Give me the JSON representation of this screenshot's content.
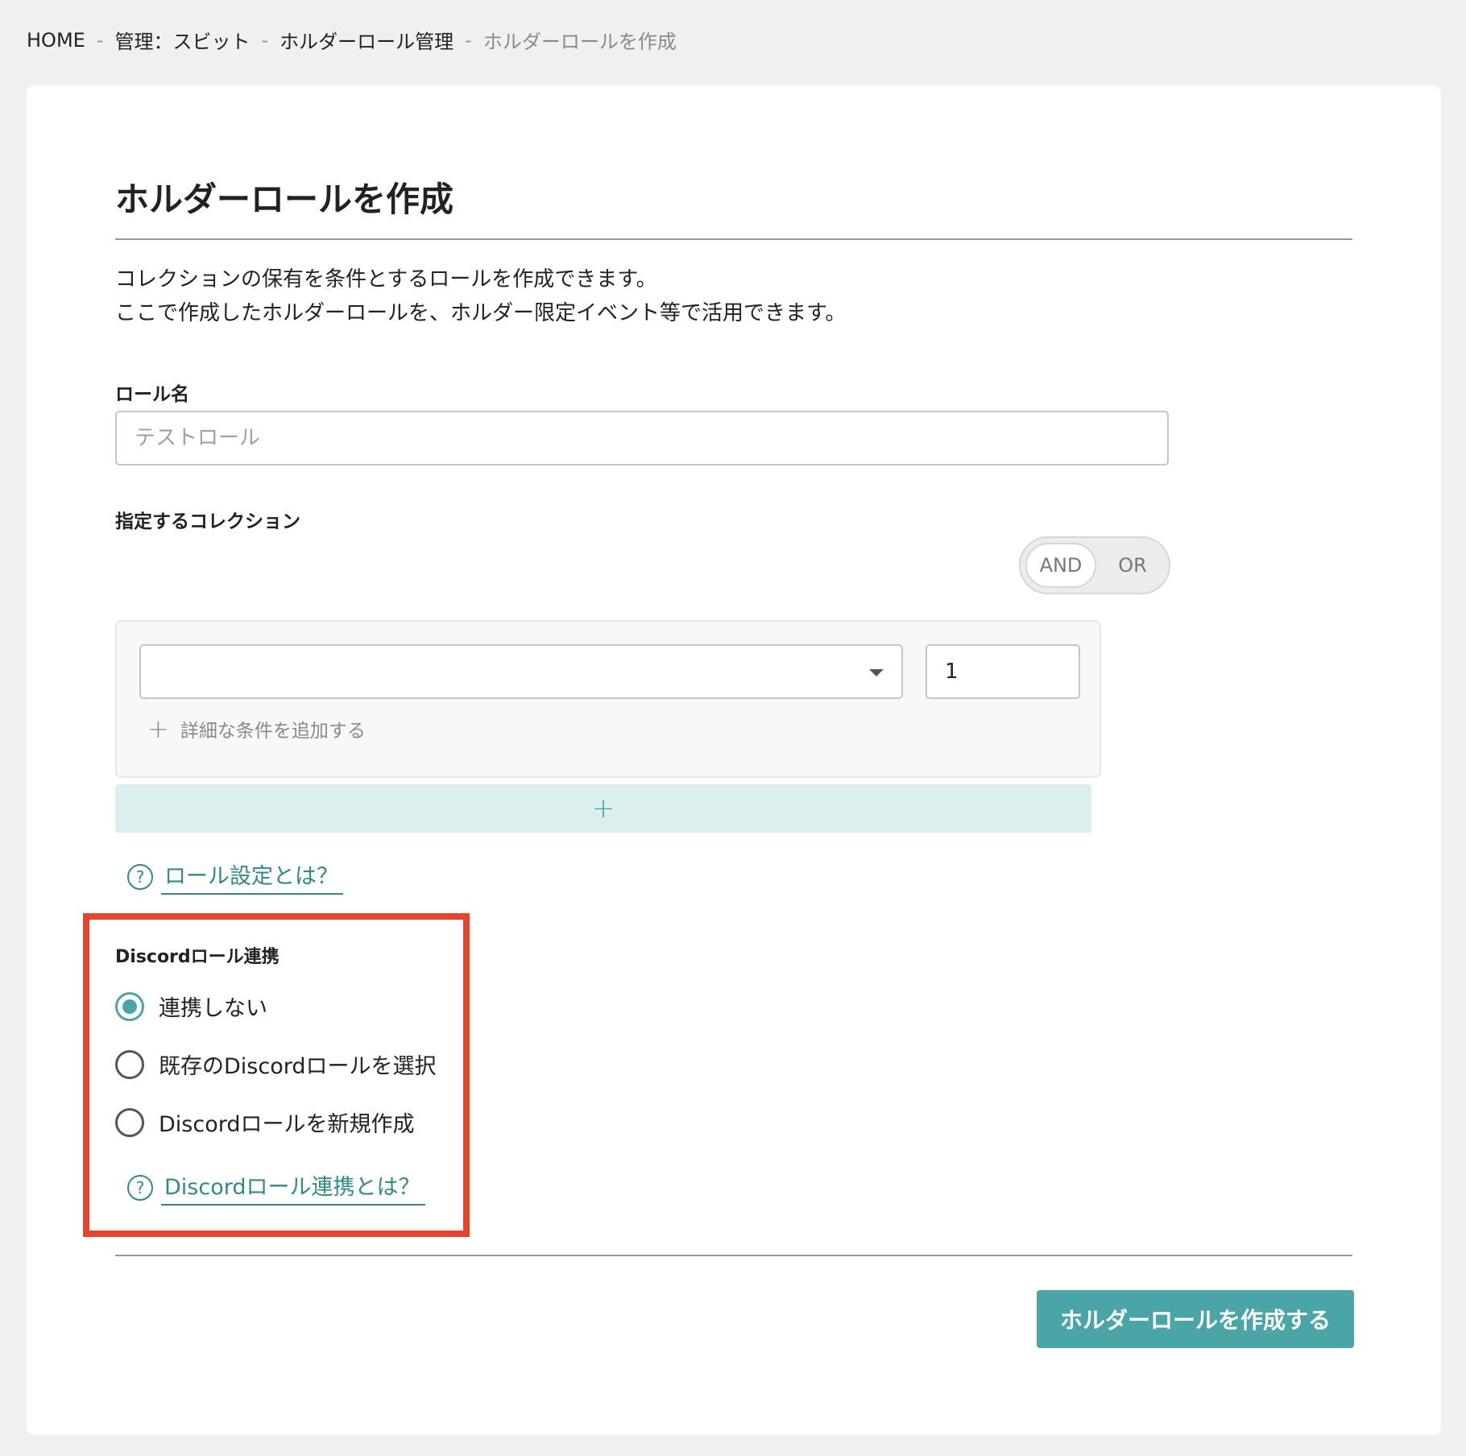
{
  "breadcrumb": {
    "items": [
      "HOME",
      "管理：スビット",
      "ホルダーロール管理"
    ],
    "separator": "-",
    "current": "ホルダーロールを作成"
  },
  "page": {
    "title": "ホルダーロールを作成",
    "description_line1": "コレクションの保有を条件とするロールを作成できます。",
    "description_line2": "ここで作成したホルダーロールを、ホルダー限定イベント等で活用できます。"
  },
  "role_name": {
    "label": "ロール名",
    "placeholder": "テストロール",
    "value": ""
  },
  "collection": {
    "label": "指定するコレクション",
    "toggle": {
      "and_label": "AND",
      "or_label": "OR",
      "selected": "AND"
    },
    "select_value": "",
    "quantity": "1",
    "add_condition_icon": "plus-icon",
    "add_condition_label": "詳細な条件を追加する",
    "add_row_label": "+"
  },
  "role_help": {
    "icon": "question-icon",
    "icon_glyph": "?",
    "label": "ロール設定とは？"
  },
  "discord": {
    "label": "Discordロール連携",
    "options": [
      "連携しない",
      "既存のDiscordロールを選択",
      "Discordロールを新規作成"
    ],
    "selected_index": 0,
    "help_icon": "question-icon",
    "help_glyph": "?",
    "help_label": "Discordロール連携とは？"
  },
  "submit_label": "ホルダーロールを作成する",
  "colors": {
    "accent": "#4aa6a6",
    "link": "#2f8a8a",
    "highlight": "#e8432d"
  }
}
